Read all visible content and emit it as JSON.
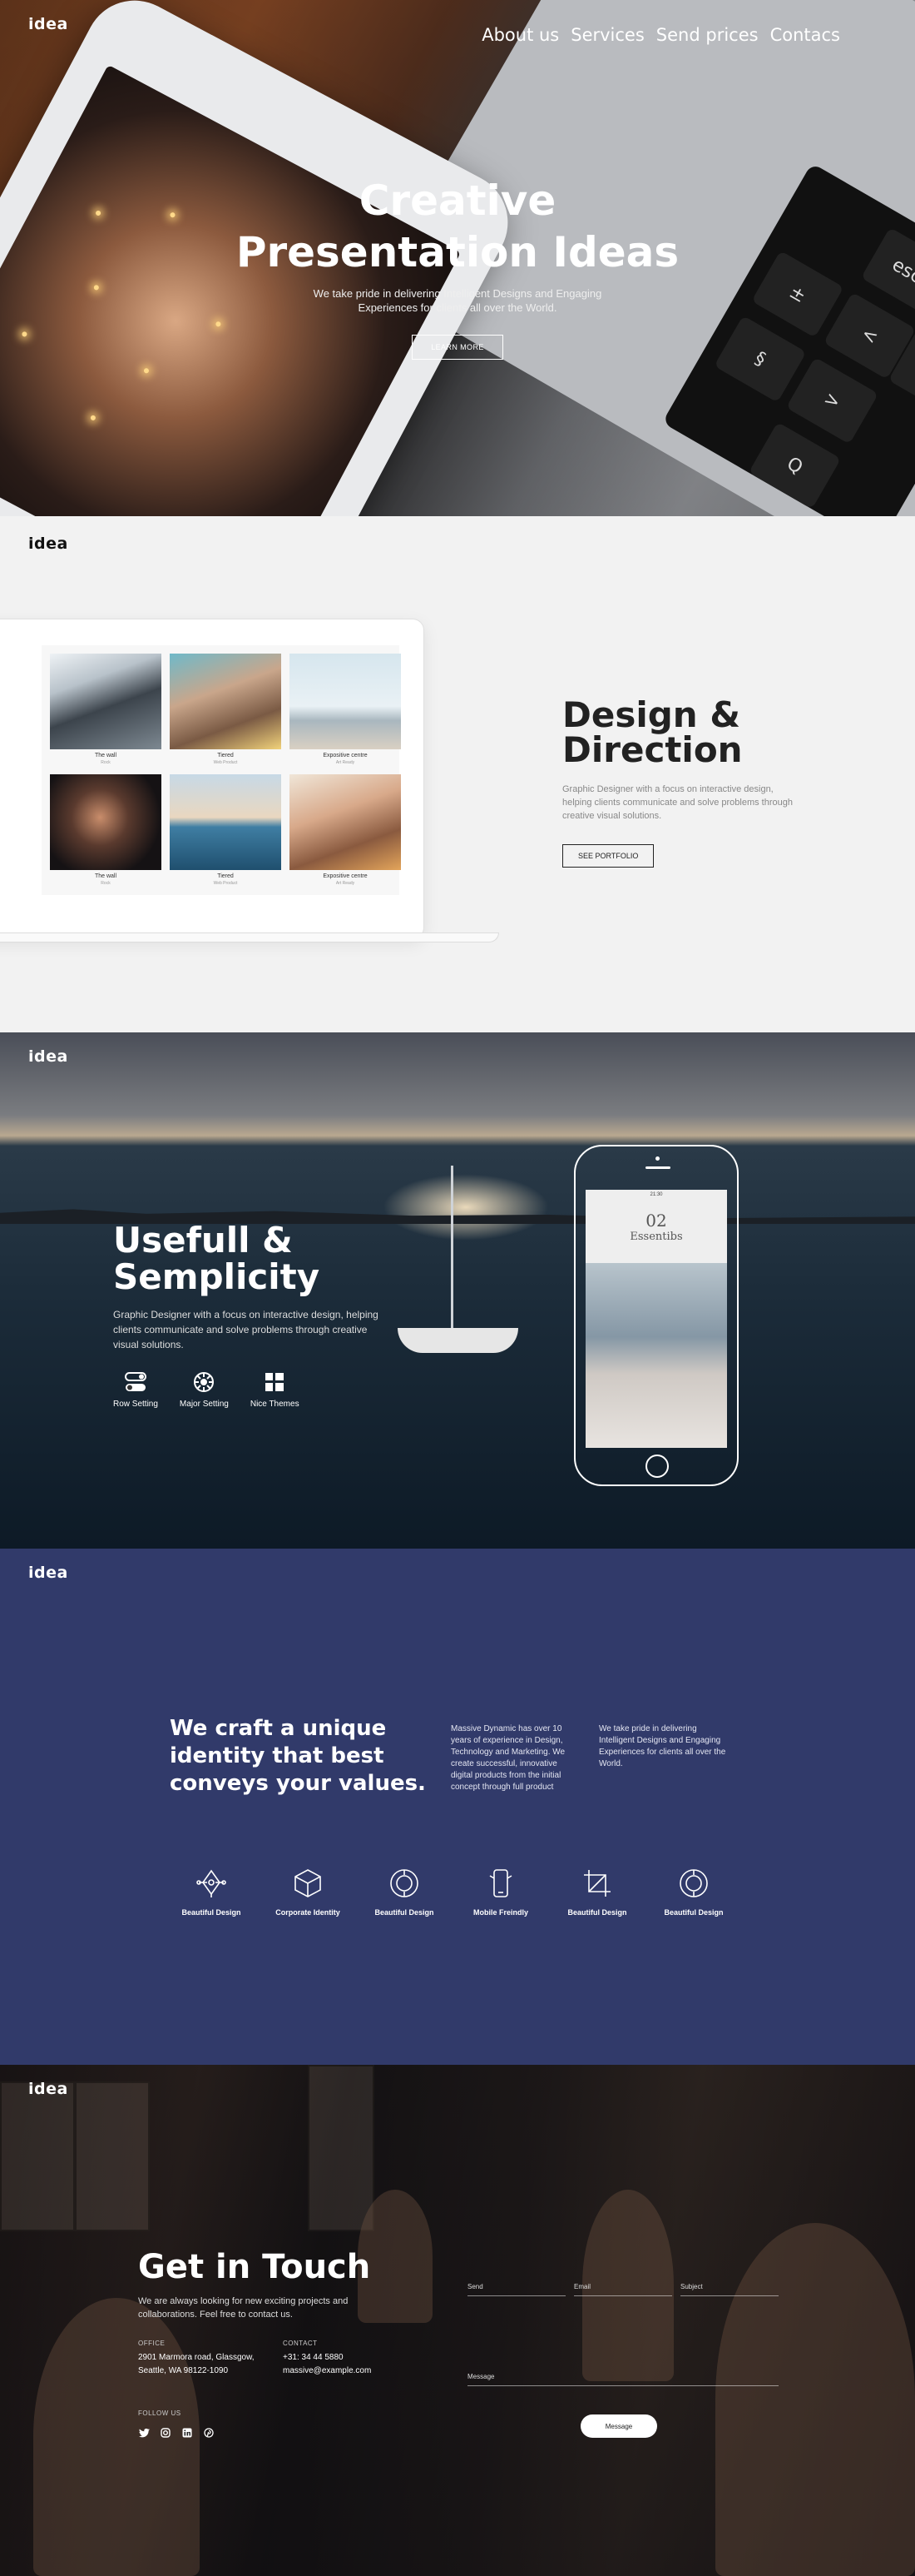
{
  "brand": {
    "logo": "idea"
  },
  "hero": {
    "nav": [
      "About us",
      "Services",
      "Send prices",
      "Contacs"
    ],
    "title_line1": "Creative",
    "title_line2": "Presentation Ideas",
    "subtitle": "We take pride in delivering Intelligent Designs and Engaging Experiences for clients all over the World.",
    "button": "LEARN MORE",
    "keys": [
      "esc",
      "±",
      "§",
      "<",
      "!",
      ">",
      "Q"
    ]
  },
  "design": {
    "title_line1": "Design &",
    "title_line2": "Direction",
    "text": "Graphic Designer with a focus on interactive design, helping clients communicate and solve problems through creative visual solutions.",
    "button": "SEE PORTFOLIO",
    "portfolio": [
      {
        "title": "The wall",
        "sub": "Rock",
        "color": "linear-gradient(160deg,#eef2f5 0%,#b8c2ca 30%,#3c444c 55%,#7d8891 100%)"
      },
      {
        "title": "Tiered",
        "sub": "Web Product",
        "color": "linear-gradient(160deg,#6fb9c9 0%,#c9a68b 40%,#7a5a44 70%,#f1d27a 100%)"
      },
      {
        "title": "Expositive centre",
        "sub": "Art Ready",
        "color": "linear-gradient(180deg,#d6e6ee 0%,#e9f1f5 55%,#a9b7bf 70%,#d9d0c3 100%)"
      },
      {
        "title": "The wall",
        "sub": "Rock",
        "color": "radial-gradient(circle at 45% 45%,#c98d6b 0%,#5a3a2e 35%,#151214 75%)"
      },
      {
        "title": "Tiered",
        "sub": "Web Product",
        "color": "linear-gradient(180deg,#c7d9e6 0%,#e9d7c0 45%,#3f7ea3 55%,#1f4f6e 100%)"
      },
      {
        "title": "Expositive centre",
        "sub": "Art Ready",
        "color": "linear-gradient(160deg,#f0e6d8 0%,#d8a98a 40%,#8a5a3f 70%,#e3a45a 100%)"
      }
    ]
  },
  "simplicity": {
    "title_line1": "Usefull &",
    "title_line2": "Semplicity",
    "text": "Graphic Designer with a focus on interactive design, helping clients communicate and solve problems through creative visual solutions.",
    "features": [
      {
        "label": "Row Setting",
        "icon": "toggle-icon"
      },
      {
        "label": "Major Setting",
        "icon": "settings-icon"
      },
      {
        "label": "Nice Themes",
        "icon": "grid-icon"
      }
    ],
    "phone": {
      "time": "21:30",
      "number": "02",
      "name": "Essentibs"
    }
  },
  "craft": {
    "headline": "We craft a unique identity that best conveys your values.",
    "col1": "Massive Dynamic has over 10 years of experience in Design, Technology and Marketing. We create successful, innovative digital products from the initial concept through full product",
    "col2": "We take pride in delivering Intelligent Designs and Engaging Experiences for clients all over the World.",
    "services": [
      {
        "label": "Beautiful Design",
        "icon": "pen-tool-icon"
      },
      {
        "label": "Corporate Identity",
        "icon": "cube-icon"
      },
      {
        "label": "Beautiful Design",
        "icon": "circle-target-icon"
      },
      {
        "label": "Mobile Freindly",
        "icon": "mobile-icon"
      },
      {
        "label": "Beautiful Design",
        "icon": "crop-icon"
      },
      {
        "label": "Beautiful Design",
        "icon": "circle-target-icon"
      }
    ]
  },
  "contact": {
    "title": "Get in Touch",
    "text": "We are always looking for new exciting projects and collaborations. Feel free to contact us.",
    "office_label": "OFFICE",
    "office_line1": "2901 Marmora road, Glassgow,",
    "office_line2": "Seattle, WA 98122-1090",
    "contact_label": "CONTACT",
    "phone": "+31: 34 44 5880",
    "email": "massive@example.com",
    "follow_label": "FOLLOW US",
    "social": [
      "twitter-icon",
      "instagram-icon",
      "linkedin-icon",
      "pinterest-icon"
    ],
    "form": {
      "send": "Send",
      "email": "Email",
      "subject": "Subject",
      "message": "Message",
      "button": "Message"
    }
  }
}
